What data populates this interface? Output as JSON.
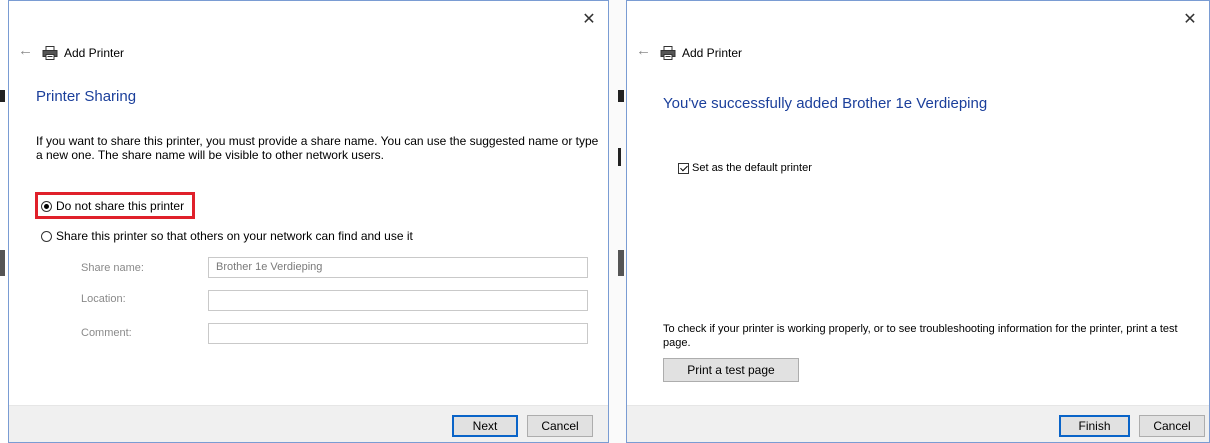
{
  "dialog1": {
    "close_glyph": "✕",
    "header_title": "Add Printer",
    "heading": "Printer Sharing",
    "description": "If you want to share this printer, you must provide a share name. You can use the suggested name or type a new one. The share name will be visible to other network users.",
    "option_no_share": "Do not share this printer",
    "option_share": "Share this printer so that others on your network can find and use it",
    "share_name_label": "Share name:",
    "share_name_value": "Brother 1e Verdieping",
    "location_label": "Location:",
    "location_value": "",
    "comment_label": "Comment:",
    "comment_value": "",
    "next_label": "Next",
    "cancel_label": "Cancel",
    "selected_option": "no_share"
  },
  "dialog2": {
    "close_glyph": "✕",
    "header_title": "Add Printer",
    "heading": "You've successfully added Brother 1e Verdieping",
    "default_printer_label": "Set as the default printer",
    "default_printer_checked": true,
    "test_info": "To check if your printer is working properly, or to see troubleshooting information for the printer, print a test page.",
    "print_test_label": "Print a test page",
    "finish_label": "Finish",
    "cancel_label": "Cancel"
  },
  "colors": {
    "heading_blue": "#1b3f9b",
    "highlight_red": "#e0202a",
    "primary_border": "#0a64c8"
  },
  "icons": [
    "back-arrow-icon",
    "printer-icon",
    "close-icon"
  ]
}
